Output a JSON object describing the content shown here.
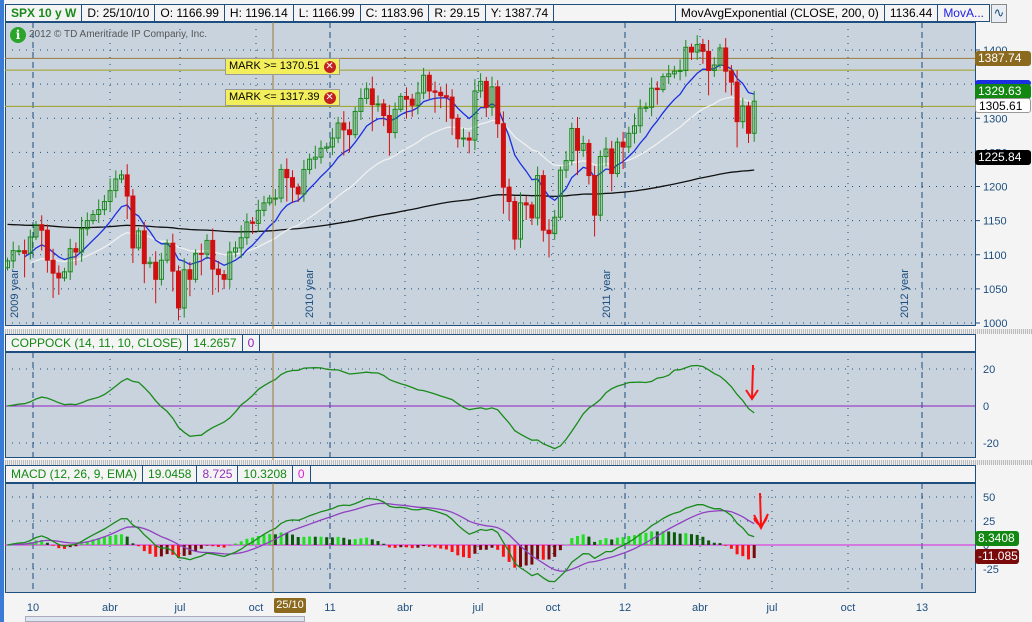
{
  "header": {
    "symbol": "SPX 10 y W",
    "date": "D: 25/10/10",
    "open": "O: 1166.99",
    "high": "H: 1196.14",
    "low": "L: 1166.99",
    "close": "C: 1183.96",
    "range": "R: 29.15",
    "y": "Y: 1387.74",
    "study": "MovAvgExponential (CLOSE, 200, 0)",
    "study_value": "1136.44",
    "study2": "MovA..."
  },
  "copyright": "2012 © TD Ameritrade IP Company, Inc.",
  "marks": [
    {
      "label": "MARK >= 1370.51",
      "value": 1370.51
    },
    {
      "label": "MARK <= 1317.39",
      "value": 1317.39
    }
  ],
  "price_labels": {
    "cursor": "1387.74",
    "last": "1329.63",
    "ema_white": "1305.61",
    "ema200": "1225.84"
  },
  "price_axis": [
    "1400",
    "1350",
    "1300",
    "1250",
    "1200",
    "1150",
    "1100",
    "1050",
    "1000"
  ],
  "year_labels": [
    "2009 year",
    "2010 year",
    "2011 year",
    "2012 year"
  ],
  "coppock": {
    "title": "COPPOCK (14, 11, 10, CLOSE)",
    "value": "14.2657",
    "zero": "0",
    "axis": [
      "20",
      "0",
      "-20"
    ]
  },
  "macd": {
    "title": "MACD (12, 26, 9, EMA)",
    "value": "19.0458",
    "avg": "8.725",
    "diff": "10.3208",
    "zero": "0",
    "axis": [
      "50",
      "25",
      "0",
      "-25"
    ],
    "label_value": "8.3408",
    "label_diff": "-11.085"
  },
  "date_axis": [
    "10",
    "abr",
    "jul",
    "oct",
    "11",
    "abr",
    "jul",
    "oct",
    "12",
    "abr",
    "jul",
    "oct",
    "13"
  ],
  "cursor_date": "25/10",
  "colors": {
    "up": "#1a8a1a",
    "down": "#d01010",
    "ema_fast": "#1a2fe0",
    "ema_slow": "#f0f0f0",
    "ema200": "#111111",
    "panel_bg": "#c8d3de"
  },
  "chart_data": {
    "type": "candlestick",
    "interval": "weekly",
    "first_bar": "2009-11-23",
    "closes": [
      1091,
      1106,
      1106,
      1102,
      1126,
      1144,
      1136,
      1092,
      1073,
      1066,
      1075,
      1109,
      1104,
      1138,
      1150,
      1159,
      1166,
      1178,
      1194,
      1211,
      1217,
      1186,
      1110,
      1135,
      1087,
      1089,
      1064,
      1092,
      1117,
      1076,
      1022,
      1078,
      1064,
      1102,
      1101,
      1121,
      1079,
      1071,
      1064,
      1104,
      1110,
      1125,
      1148,
      1146,
      1165,
      1176,
      1183,
      1183,
      1225,
      1213,
      1199,
      1189,
      1225,
      1240,
      1243,
      1256,
      1258,
      1271,
      1293,
      1283,
      1276,
      1310,
      1329,
      1343,
      1320,
      1321,
      1304,
      1279,
      1313,
      1332,
      1328,
      1319,
      1337,
      1363,
      1340,
      1338,
      1333,
      1331,
      1300,
      1270,
      1271,
      1268,
      1340,
      1354,
      1316,
      1346,
      1292,
      1199,
      1178,
      1123,
      1176,
      1173,
      1154,
      1216,
      1136,
      1131,
      1155,
      1224,
      1238,
      1285,
      1253,
      1263,
      1216,
      1158,
      1244,
      1255,
      1219,
      1265,
      1258,
      1278,
      1289,
      1315,
      1316,
      1344,
      1342,
      1361,
      1365,
      1369,
      1370,
      1404,
      1397,
      1408,
      1398,
      1370,
      1378,
      1403,
      1369,
      1353,
      1295,
      1318,
      1278,
      1325
    ],
    "ylim": [
      1000,
      1420
    ]
  }
}
